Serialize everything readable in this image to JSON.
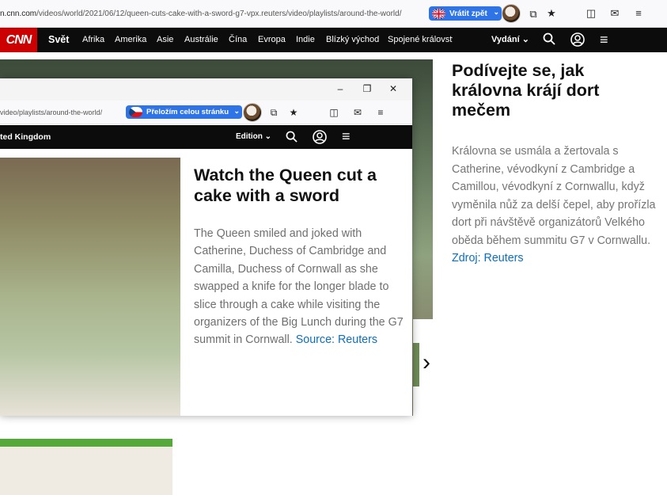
{
  "back_browser": {
    "url_domain": "n.cnn.com",
    "url_path": "/videos/world/2021/06/12/queen-cuts-cake-with-a-sword-g7-vpx.reuters/video/playlists/around-the-world/",
    "translate_label": "Vrátit zpět",
    "translate_flag": "uk-flag-icon"
  },
  "back_nav": {
    "logo": "CNN",
    "section": "Svět",
    "items": [
      "Afrika",
      "Amerika",
      "Asie",
      "Austrálie",
      "Čína",
      "Evropa",
      "Indie",
      "Blízký východ",
      "Spojené království"
    ],
    "edition": "Vydání"
  },
  "back_article": {
    "title": "Podívejte se, jak královna krájí dort mečem",
    "description": "Královna se usmála a žertovala s Catherine, vévodkyní z Cambridge a Camillou, vévodkyní z Cornwallu, když vyměnila nůž za delší čepel, aby prořízla dort při návštěvě organizátorů Velkého oběda během summitu G7 v Cornwallu.",
    "source": "Zdroj: Reuters"
  },
  "front_window": {
    "url_path": "video/playlists/around-the-world/",
    "translate_label": "Přeložím celou stránku",
    "translate_flag": "cz-flag-icon",
    "nav_left": "ted Kingdom",
    "edition": "Edition",
    "title": "Watch the Queen cut a cake with a sword",
    "description": "The Queen smiled and joked with Catherine, Duchess of Cambridge and Camilla, Duchess of Cornwall as she swapped a knife for the longer blade to slice through a cake while visiting the organizers of the Big Lunch during the G7 summit in Cornwall.",
    "source": "Source: Reuters"
  },
  "colors": {
    "cnn_red": "#cc0000",
    "translate_blue": "#2f74e6",
    "link_blue": "#0c6fbd",
    "nav_black": "#0c0c0c"
  }
}
